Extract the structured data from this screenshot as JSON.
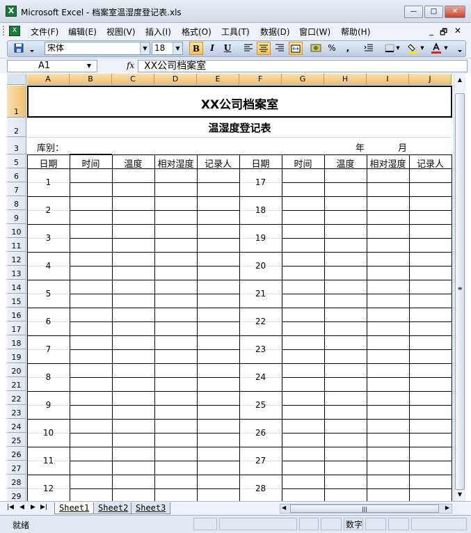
{
  "window": {
    "title": "Microsoft Excel - 档案室温湿度登记表.xls",
    "app_icon": "X",
    "minimize": "—",
    "restore": "□",
    "close": "✕"
  },
  "menu": {
    "items": [
      "文件(F)",
      "编辑(E)",
      "视图(V)",
      "插入(I)",
      "格式(O)",
      "工具(T)",
      "数据(D)",
      "窗口(W)",
      "帮助(H)"
    ],
    "doc_minimize": "_",
    "doc_restore": "🗗",
    "doc_close": "✕"
  },
  "toolbar": {
    "font_name": "宋体",
    "font_size": "18",
    "bold": "B",
    "italic": "I",
    "underline": "U",
    "percent": "%",
    "comma": ","
  },
  "formula_bar": {
    "name_box": "A1",
    "fx": "fx",
    "value": "XX公司档案室"
  },
  "columns": [
    "A",
    "B",
    "C",
    "D",
    "E",
    "F",
    "G",
    "H",
    "I",
    "J"
  ],
  "rows": [
    "1",
    "2",
    "3",
    "5",
    "6",
    "7",
    "8",
    "9",
    "10",
    "11",
    "12",
    "13",
    "14",
    "15",
    "16",
    "17",
    "18",
    "19",
    "20",
    "21",
    "22",
    "23",
    "24",
    "25",
    "26",
    "27",
    "28",
    "29"
  ],
  "sheet": {
    "title": "XX公司档案室",
    "subtitle": "温湿度登记表",
    "warehouse_label": "库别：",
    "year_label": "年",
    "month_label": "月",
    "headers": [
      "日期",
      "时间",
      "温度",
      "相对湿度",
      "记录人",
      "日期",
      "时间",
      "温度",
      "相对湿度",
      "记录人"
    ],
    "left_days": [
      "1",
      "2",
      "3",
      "4",
      "5",
      "6",
      "7",
      "8",
      "9",
      "10",
      "11",
      "12"
    ],
    "right_days": [
      "17",
      "18",
      "19",
      "20",
      "21",
      "22",
      "23",
      "24",
      "25",
      "26",
      "27",
      "28"
    ]
  },
  "tabs": {
    "names": [
      "Sheet1",
      "Sheet2",
      "Sheet3"
    ],
    "active": "Sheet1"
  },
  "status": {
    "ready": "就绪",
    "mode": "数字"
  }
}
